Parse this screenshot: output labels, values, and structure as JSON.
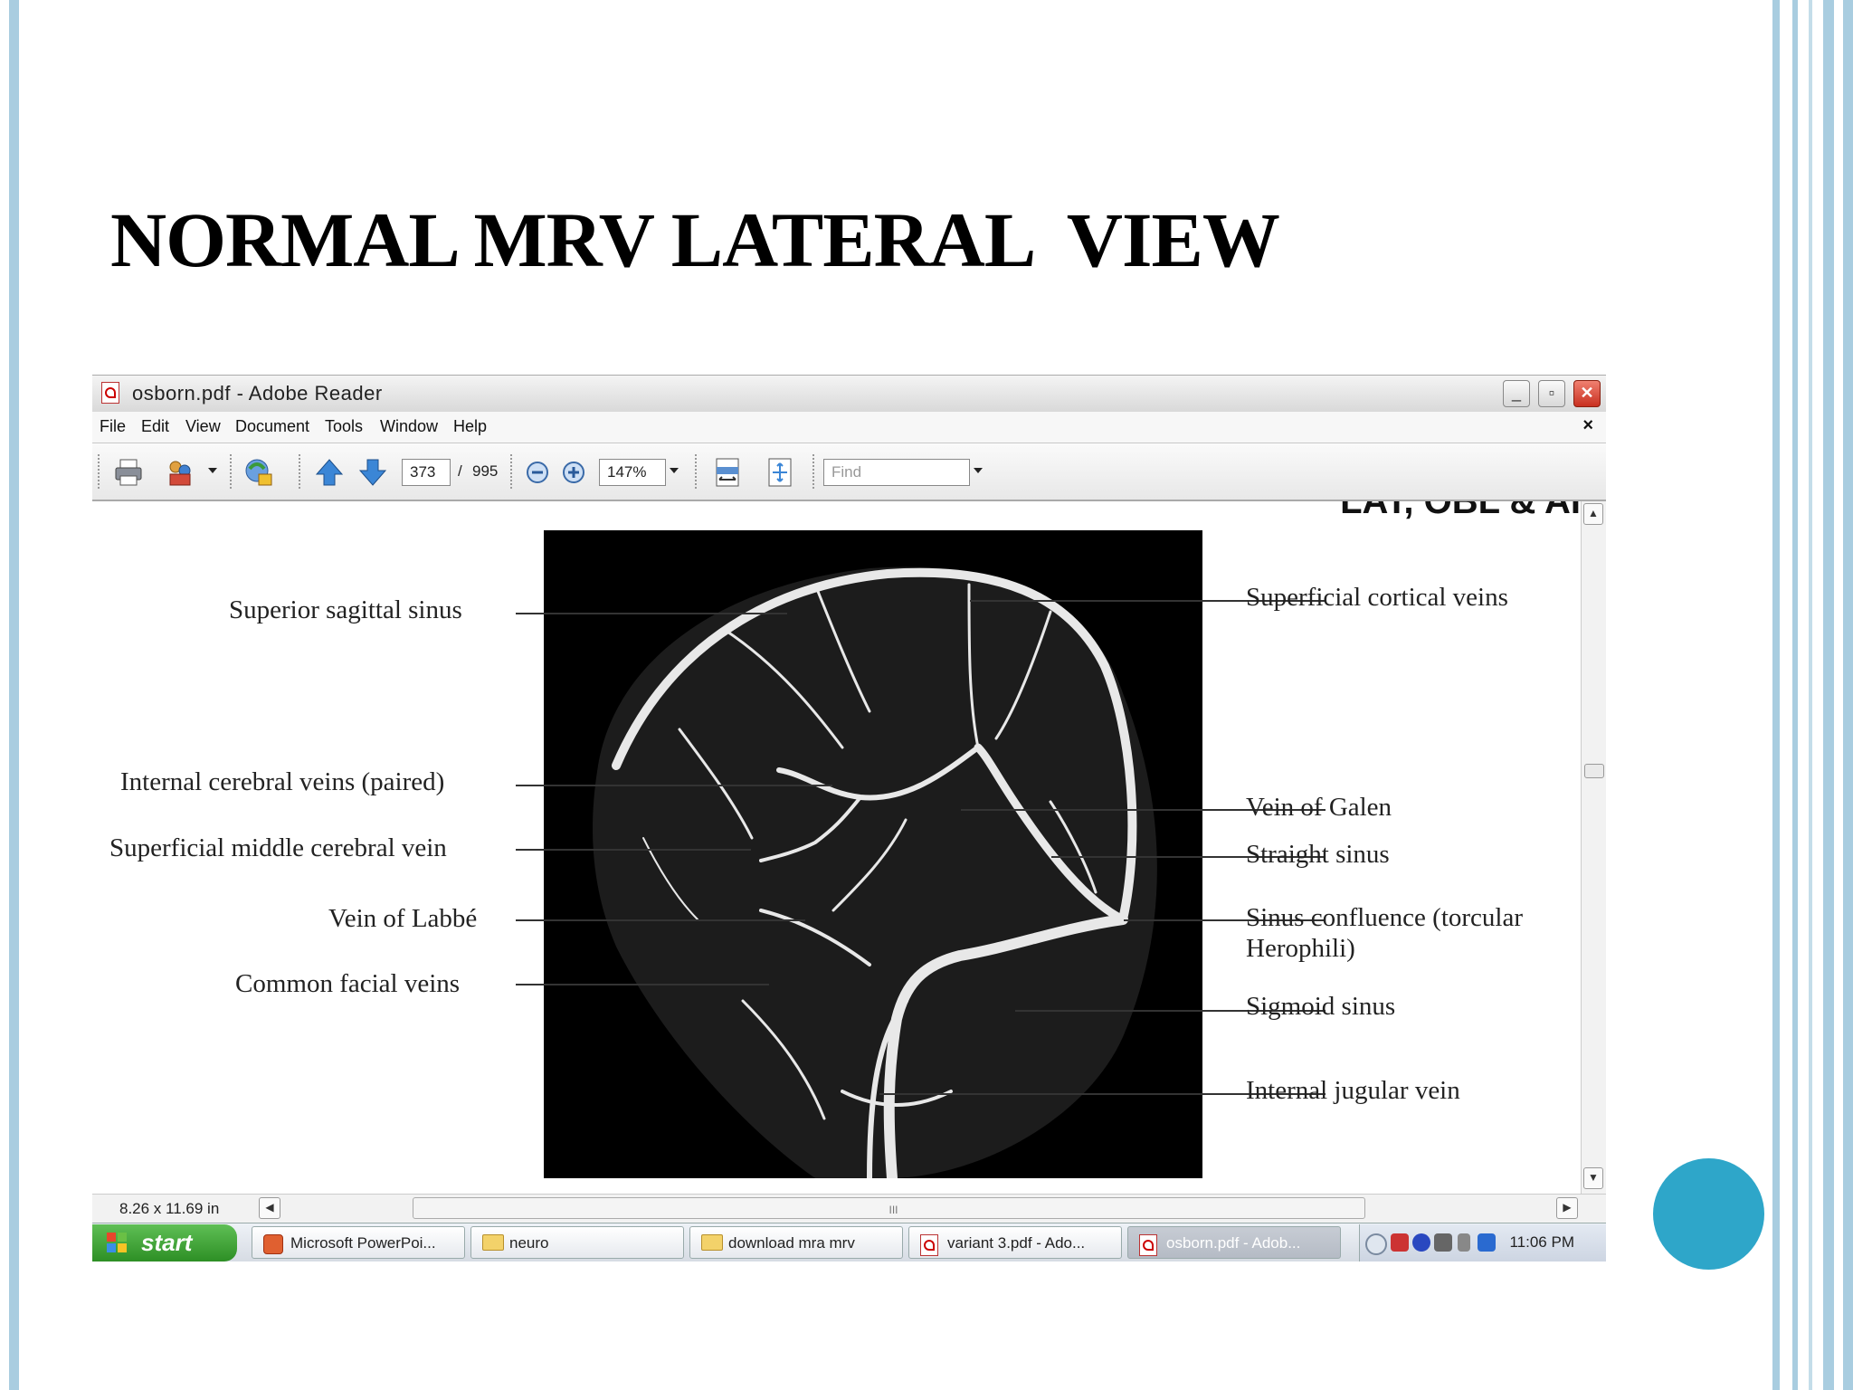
{
  "slide": {
    "title": "NORMAL MRV LATERAL  VIEW",
    "accent_color": "#2ea6c9",
    "frame_color": "#a9cde0"
  },
  "window": {
    "title": "osborn.pdf - Adobe Reader",
    "minimize": "_",
    "restore": "▫",
    "close": "✕"
  },
  "menu": {
    "items": [
      "File",
      "Edit",
      "View",
      "Document",
      "Tools",
      "Window",
      "Help"
    ],
    "close": "×"
  },
  "toolbar": {
    "page_current": "373",
    "page_separator": "/",
    "page_total": "995",
    "zoom": "147%",
    "find_placeholder": "Find"
  },
  "document": {
    "header_clip": "LAT, OBL & AI",
    "labels_left": [
      "Superior sagittal sinus",
      "Internal cerebral veins (paired)",
      "Superficial middle cerebral vein",
      "Vein of Labbé",
      "Common facial veins"
    ],
    "labels_right": [
      "Superficial cortical veins",
      "Vein of Galen",
      "Straight sinus",
      "Sinus confluence (torcular",
      "Herophili)",
      "Sigmoid sinus",
      "Internal jugular vein"
    ]
  },
  "statusbar": {
    "page_size": "8.26 x 11.69 in",
    "grip": "III"
  },
  "taskbar": {
    "start": "start",
    "tasks": [
      "Microsoft PowerPoi...",
      "neuro",
      "download mra mrv",
      "variant 3.pdf - Ado...",
      "osborn.pdf - Adob..."
    ],
    "clock": "11:06 PM"
  }
}
